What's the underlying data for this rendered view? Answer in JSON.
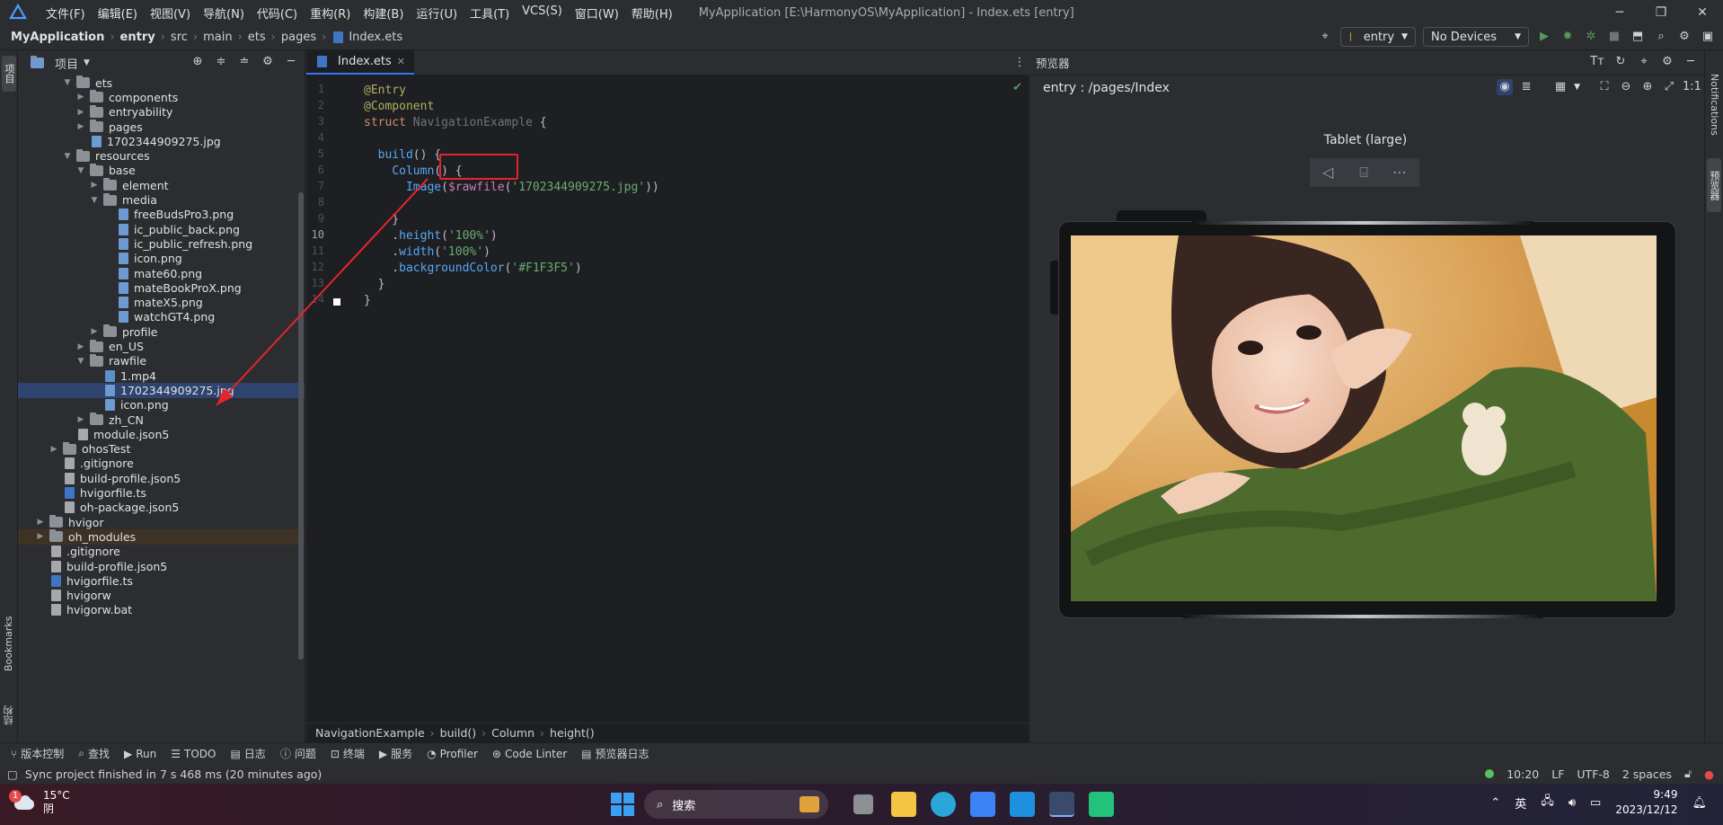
{
  "menubar": {
    "items": [
      "文件(F)",
      "编辑(E)",
      "视图(V)",
      "导航(N)",
      "代码(C)",
      "重构(R)",
      "构建(B)",
      "运行(U)",
      "工具(T)",
      "VCS(S)",
      "窗口(W)",
      "帮助(H)"
    ],
    "title": "MyApplication [E:\\HarmonyOS\\MyApplication] - Index.ets [entry]"
  },
  "navbar": {
    "crumbs": [
      "MyApplication",
      "entry",
      "src",
      "main",
      "ets",
      "pages",
      "Index.ets"
    ],
    "module": "entry",
    "device": "No Devices"
  },
  "left_strip": {
    "project_label": "项目",
    "bookmarks_label": "Bookmarks",
    "structure_label": "结构"
  },
  "project": {
    "title": "项目",
    "tree": [
      {
        "label": "ets",
        "kind": "folder",
        "depth": 3,
        "open": true
      },
      {
        "label": "components",
        "kind": "folder",
        "depth": 4,
        "open": false
      },
      {
        "label": "entryability",
        "kind": "folder",
        "depth": 4,
        "open": false
      },
      {
        "label": "pages",
        "kind": "folder",
        "depth": 4,
        "open": false
      },
      {
        "label": "1702344909275.jpg",
        "kind": "img",
        "depth": 4
      },
      {
        "label": "resources",
        "kind": "folder",
        "depth": 3,
        "open": true
      },
      {
        "label": "base",
        "kind": "folder",
        "depth": 4,
        "open": true
      },
      {
        "label": "element",
        "kind": "folder",
        "depth": 5,
        "open": false
      },
      {
        "label": "media",
        "kind": "folder",
        "depth": 5,
        "open": true
      },
      {
        "label": "freeBudsPro3.png",
        "kind": "img",
        "depth": 6
      },
      {
        "label": "ic_public_back.png",
        "kind": "img",
        "depth": 6
      },
      {
        "label": "ic_public_refresh.png",
        "kind": "img",
        "depth": 6
      },
      {
        "label": "icon.png",
        "kind": "img",
        "depth": 6
      },
      {
        "label": "mate60.png",
        "kind": "img",
        "depth": 6
      },
      {
        "label": "mateBookProX.png",
        "kind": "img",
        "depth": 6
      },
      {
        "label": "mateX5.png",
        "kind": "img",
        "depth": 6
      },
      {
        "label": "watchGT4.png",
        "kind": "img",
        "depth": 6
      },
      {
        "label": "profile",
        "kind": "folder",
        "depth": 5,
        "open": false
      },
      {
        "label": "en_US",
        "kind": "folder",
        "depth": 4,
        "open": false
      },
      {
        "label": "rawfile",
        "kind": "folder",
        "depth": 4,
        "open": true
      },
      {
        "label": "1.mp4",
        "kind": "file",
        "depth": 5
      },
      {
        "label": "1702344909275.jpg",
        "kind": "img",
        "depth": 5,
        "selected": true
      },
      {
        "label": "icon.png",
        "kind": "img",
        "depth": 5
      },
      {
        "label": "zh_CN",
        "kind": "folder",
        "depth": 4,
        "open": false
      },
      {
        "label": "module.json5",
        "kind": "json",
        "depth": 3
      },
      {
        "label": "ohosTest",
        "kind": "folder",
        "depth": 2,
        "open": false
      },
      {
        "label": ".gitignore",
        "kind": "txt",
        "depth": 2
      },
      {
        "label": "build-profile.json5",
        "kind": "json",
        "depth": 2
      },
      {
        "label": "hvigorfile.ts",
        "kind": "ts",
        "depth": 2
      },
      {
        "label": "oh-package.json5",
        "kind": "json",
        "depth": 2
      },
      {
        "label": "hvigor",
        "kind": "folder",
        "depth": 1,
        "open": false
      },
      {
        "label": "oh_modules",
        "kind": "folder",
        "depth": 1,
        "open": false,
        "highlight": true
      },
      {
        "label": ".gitignore",
        "kind": "txt",
        "depth": 1
      },
      {
        "label": "build-profile.json5",
        "kind": "json",
        "depth": 1
      },
      {
        "label": "hvigorfile.ts",
        "kind": "ts",
        "depth": 1
      },
      {
        "label": "hvigorw",
        "kind": "txt",
        "depth": 1
      },
      {
        "label": "hvigorw.bat",
        "kind": "txt",
        "depth": 1
      }
    ]
  },
  "editor": {
    "tab": "Index.ets",
    "line_numbers": [
      "1",
      "2",
      "3",
      "4",
      "5",
      "6",
      "7",
      "8",
      "9",
      "10",
      "11",
      "12",
      "13",
      "14"
    ],
    "lines": [
      [
        [
          "an",
          "@Entry"
        ]
      ],
      [
        [
          "an",
          "@Component"
        ]
      ],
      [
        [
          "k",
          "struct "
        ],
        [
          "ty",
          "NavigationExample "
        ],
        [
          "pl",
          "{"
        ]
      ],
      [],
      [
        [
          "pl",
          "  "
        ],
        [
          "fn",
          "build"
        ],
        [
          "pl",
          "() {"
        ]
      ],
      [
        [
          "pl",
          "    "
        ],
        [
          "fn",
          "Column"
        ],
        [
          "pl",
          "() {"
        ]
      ],
      [
        [
          "pl",
          "      "
        ],
        [
          "fn",
          "Image"
        ],
        [
          "pl",
          "("
        ],
        [
          "pu",
          "$rawfile"
        ],
        [
          "pl",
          "("
        ],
        [
          "st",
          "'1702344909275.jpg'"
        ],
        [
          "pl",
          "))"
        ]
      ],
      [],
      [
        [
          "pl",
          "    }"
        ]
      ],
      [
        [
          "pl",
          "    ."
        ],
        [
          "fn",
          "height"
        ],
        [
          "pl",
          "("
        ],
        [
          "st",
          "'100%'"
        ],
        [
          "pl",
          ")"
        ]
      ],
      [
        [
          "pl",
          "    ."
        ],
        [
          "fn",
          "width"
        ],
        [
          "pl",
          "("
        ],
        [
          "st",
          "'100%'"
        ],
        [
          "pl",
          ")"
        ]
      ],
      [
        [
          "pl",
          "    ."
        ],
        [
          "fn",
          "backgroundColor"
        ],
        [
          "pl",
          "("
        ],
        [
          "st",
          "'#F1F3F5'"
        ],
        [
          "pl",
          ")"
        ]
      ],
      [
        [
          "pl",
          "  }"
        ]
      ],
      [
        [
          "pl",
          "}"
        ]
      ]
    ],
    "breadcrumb": [
      "NavigationExample",
      "build()",
      "Column",
      "height()"
    ]
  },
  "preview": {
    "title": "预览器",
    "route": "entry : /pages/Index",
    "device": "Tablet (large)"
  },
  "right_strip": {
    "notifications": "Notifications",
    "previewer": "预览器"
  },
  "toolwindows": [
    "版本控制",
    "查找",
    "Run",
    "TODO",
    "日志",
    "问题",
    "终端",
    "服务",
    "Profiler",
    "Code Linter",
    "预览器日志"
  ],
  "statusbar": {
    "message": "Sync project finished in 7 s 468 ms (20 minutes ago)",
    "position": "10:20",
    "line_sep": "LF",
    "encoding": "UTF-8",
    "indent": "2 spaces"
  },
  "taskbar": {
    "badge": "1",
    "temp": "15°C",
    "weather": "阴",
    "search": "搜索",
    "ime": "英",
    "time": "9:49",
    "date": "2023/12/12"
  },
  "colors": {
    "accent": "#3574f0",
    "annotation_red": "#e5252a",
    "selected_row": "#2e436e"
  }
}
